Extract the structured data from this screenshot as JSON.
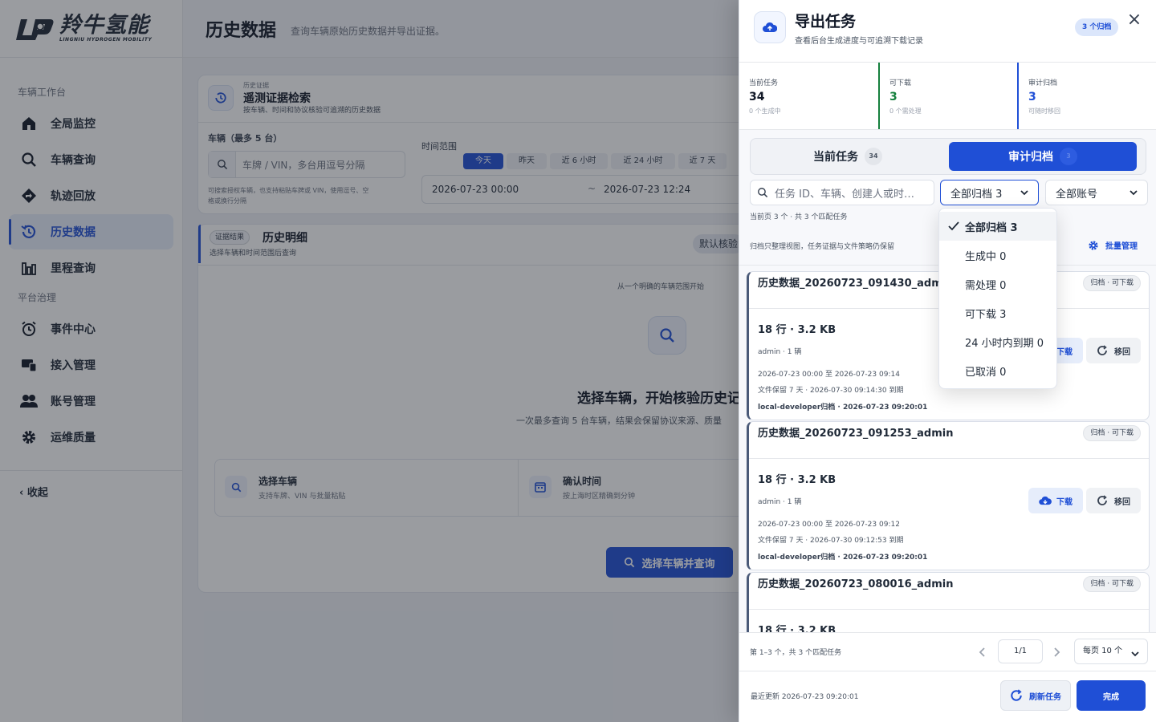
{
  "brand": {
    "cn": "羚牛氢能",
    "en": "LINGNIU HYDROGEN MOBILITY"
  },
  "sidebar": {
    "group1": "车辆工作台",
    "items1": [
      {
        "label": "全局监控",
        "icon": "home-icon"
      },
      {
        "label": "车辆查询",
        "icon": "search-icon"
      },
      {
        "label": "轨迹回放",
        "icon": "route-icon"
      },
      {
        "label": "历史数据",
        "icon": "history-icon",
        "active": true
      },
      {
        "label": "里程查询",
        "icon": "bar-chart-icon"
      }
    ],
    "group2": "平台治理",
    "items2": [
      {
        "label": "事件中心",
        "icon": "alarm-icon"
      },
      {
        "label": "接入管理",
        "icon": "device-icon"
      },
      {
        "label": "账号管理",
        "icon": "users-icon"
      },
      {
        "label": "运维质量",
        "icon": "gear-icon"
      }
    ],
    "collapse": "收起"
  },
  "page": {
    "title": "历史数据",
    "subtitle": "查询车辆原始历史数据并导出证据。",
    "search_card": {
      "eyebrow": "历史证据",
      "title": "遥测证据检索",
      "desc": "按车辆、时间和协议核验可追溯的历史数据",
      "vehicle_label": "车辆（最多 5 台）",
      "vehicle_placeholder": "车牌 / VIN，多台用逗号分隔",
      "vehicle_hint1": "可搜索授权车辆，也支持粘贴车牌或 VIN，使用逗号、空",
      "vehicle_hint2": "格或换行分隔",
      "time_label": "时间范围",
      "time_tabs": [
        "今天",
        "昨天",
        "近 6 小时",
        "近 24 小时",
        "近 7 天"
      ],
      "time_start": "2026-07-23 00:00",
      "time_sep": "~",
      "time_end": "2026-07-23 12:24"
    },
    "result_card": {
      "tag": "证据结果",
      "title": "历史明细",
      "desc": "选择车辆和时间范围后查询",
      "right_badge": "默认核验",
      "empty_eyebrow": "从一个明确的车辆范围开始",
      "empty_title": "选择车辆，开始核验历史记",
      "empty_desc": "一次最多查询 5 台车辆，结果会保留协议来源、质量",
      "steps": [
        {
          "title": "选择车辆",
          "desc": "支持车牌、VIN 与批量粘贴"
        },
        {
          "title": "确认时间",
          "desc": "按上海时区精确到分钟"
        }
      ],
      "cta": "选择车辆并查询"
    }
  },
  "drawer": {
    "title": "导出任务",
    "subtitle": "查看后台生成进度与可追溯下载记录",
    "badge": "3 个归档",
    "close": "×",
    "stats": [
      {
        "label": "当前任务",
        "value": "34",
        "sub": "0 个生成中",
        "color": "#111827"
      },
      {
        "label": "可下载",
        "value": "3",
        "sub": "0 个需处理",
        "color": "#15803d"
      },
      {
        "label": "审计归档",
        "value": "3",
        "sub": "可随时移回",
        "color": "#1f4fd6"
      }
    ],
    "tabs": [
      {
        "label": "当前任务",
        "count": "34"
      },
      {
        "label": "审计归档",
        "count": "3"
      }
    ],
    "search_placeholder": "任务 ID、车辆、创建人或时…",
    "filter_archive": "全部归档 3",
    "filter_account": "全部账号",
    "meta": "当前页 3 个 · 共 3 个匹配任务",
    "note": "归档只整理视图，任务证据与文件策略仍保留",
    "batch": "批量管理",
    "tasks": [
      {
        "name": "历史数据_20260723_091430_admin",
        "status": "归档 · 可下载",
        "size": "18 行 · 3.2 KB",
        "owner": "admin · 1 辆",
        "range": "2026-07-23 00:00 至 2026-07-23 09:14",
        "retention": "文件保留 7 天 · 2026-07-30 09:14:30 到期",
        "archived": "local-developer归档 · 2026-07-23 09:20:01",
        "download": "下载",
        "move": "移回"
      },
      {
        "name": "历史数据_20260723_091253_admin",
        "status": "归档 · 可下载",
        "size": "18 行 · 3.2 KB",
        "owner": "admin · 1 辆",
        "range": "2026-07-23 00:00 至 2026-07-23 09:12",
        "retention": "文件保留 7 天 · 2026-07-30 09:12:53 到期",
        "archived": "local-developer归档 · 2026-07-23 09:20:01",
        "download": "下载",
        "move": "移回"
      },
      {
        "name": "历史数据_20260723_080016_admin",
        "status": "归档 · 可下载",
        "size": "18 行 · 3.2 KB"
      }
    ],
    "pager": {
      "info": "第 1–3 个，共 3 个匹配任务",
      "page": "1/1",
      "size": "每页 10 个"
    },
    "footer": {
      "updated": "最近更新 2026-07-23 09:20:01",
      "refresh": "刷新任务",
      "done": "完成"
    }
  },
  "dropdown": {
    "options": [
      "全部归档 3",
      "生成中 0",
      "需处理 0",
      "可下载 3",
      "24 小时内到期 0",
      "已取消 0"
    ],
    "selected": "全部归档 3"
  },
  "colors": {
    "accent": "#1f4fd6",
    "success": "#15803d"
  }
}
